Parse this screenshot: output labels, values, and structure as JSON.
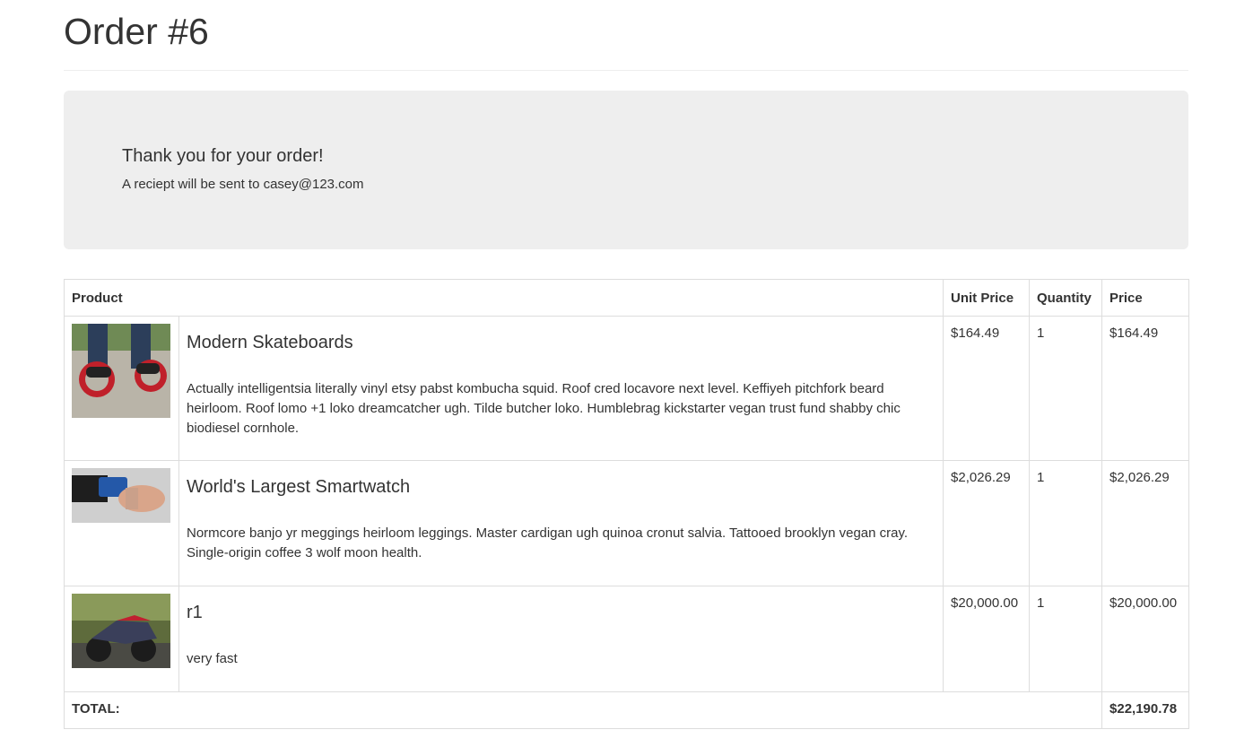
{
  "page": {
    "title": "Order #6"
  },
  "jumbotron": {
    "heading": "Thank you for your order!",
    "receipt_text": "A reciept will be sent to casey@123.com"
  },
  "table": {
    "headers": {
      "product": "Product",
      "unit_price": "Unit Price",
      "quantity": "Quantity",
      "price": "Price"
    },
    "rows": [
      {
        "name": "Modern Skateboards",
        "description": "Actually intelligentsia literally vinyl etsy pabst kombucha squid. Roof cred locavore next level. Keffiyeh pitchfork beard heirloom. Roof lomo +1 loko dreamcatcher ugh. Tilde butcher loko. Humblebrag kickstarter vegan trust fund shabby chic biodiesel cornhole.",
        "unit_price": "$164.49",
        "quantity": "1",
        "price": "$164.49",
        "image_icon": "skateboards-photo"
      },
      {
        "name": "World's Largest Smartwatch",
        "description": "Normcore banjo yr meggings heirloom leggings. Master cardigan ugh quinoa cronut salvia. Tattooed brooklyn vegan cray. Single-origin coffee 3 wolf moon health.",
        "unit_price": "$2,026.29",
        "quantity": "1",
        "price": "$2,026.29",
        "image_icon": "smartwatch-photo"
      },
      {
        "name": "r1",
        "description": "very fast",
        "unit_price": "$20,000.00",
        "quantity": "1",
        "price": "$20,000.00",
        "image_icon": "motorcycle-photo"
      }
    ],
    "total_label": "TOTAL:",
    "total_value": "$22,190.78"
  }
}
